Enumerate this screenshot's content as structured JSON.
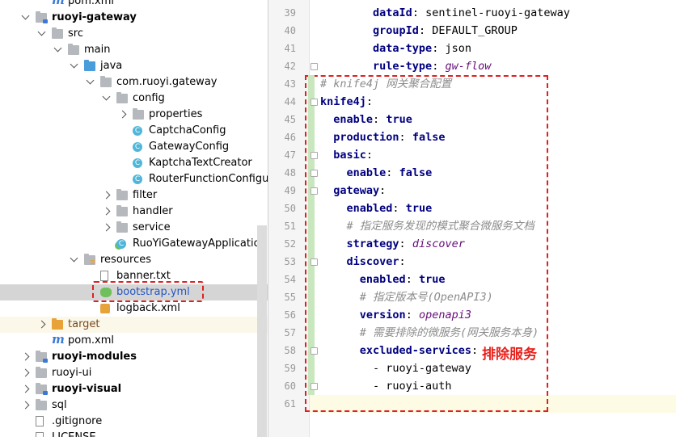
{
  "tree": {
    "rows": [
      {
        "label": "pom.xml",
        "icon": "maven-icon",
        "indent": 64,
        "arrow": "",
        "style": ""
      },
      {
        "label": "ruoyi-gateway",
        "icon": "module-folder-icon",
        "indent": 44,
        "arrow": "down",
        "style": "bold"
      },
      {
        "label": "src",
        "icon": "folder-icon",
        "indent": 64,
        "arrow": "down",
        "style": ""
      },
      {
        "label": "main",
        "icon": "folder-icon",
        "indent": 84,
        "arrow": "down",
        "style": ""
      },
      {
        "label": "java",
        "icon": "source-folder-icon",
        "indent": 104,
        "arrow": "down",
        "style": ""
      },
      {
        "label": "com.ruoyi.gateway",
        "icon": "package-icon",
        "indent": 124,
        "arrow": "down",
        "style": ""
      },
      {
        "label": "config",
        "icon": "package-icon",
        "indent": 144,
        "arrow": "down",
        "style": ""
      },
      {
        "label": "properties",
        "icon": "package-icon",
        "indent": 164,
        "arrow": "right",
        "style": ""
      },
      {
        "label": "CaptchaConfig",
        "icon": "class-icon",
        "indent": 164,
        "arrow": "",
        "style": ""
      },
      {
        "label": "GatewayConfig",
        "icon": "class-icon",
        "indent": 164,
        "arrow": "",
        "style": ""
      },
      {
        "label": "KaptchaTextCreator",
        "icon": "class-icon",
        "indent": 164,
        "arrow": "",
        "style": ""
      },
      {
        "label": "RouterFunctionConfigurat",
        "icon": "class-icon",
        "indent": 164,
        "arrow": "",
        "style": ""
      },
      {
        "label": "filter",
        "icon": "package-icon",
        "indent": 144,
        "arrow": "right",
        "style": ""
      },
      {
        "label": "handler",
        "icon": "package-icon",
        "indent": 144,
        "arrow": "right",
        "style": ""
      },
      {
        "label": "service",
        "icon": "package-icon",
        "indent": 144,
        "arrow": "right",
        "style": ""
      },
      {
        "label": "RuoYiGatewayApplication",
        "icon": "spring-class-icon",
        "indent": 144,
        "arrow": "",
        "style": ""
      },
      {
        "label": "resources",
        "icon": "resources-folder-icon",
        "indent": 104,
        "arrow": "down",
        "style": ""
      },
      {
        "label": "banner.txt",
        "icon": "text-file-icon",
        "indent": 124,
        "arrow": "",
        "style": ""
      },
      {
        "label": "bootstrap.yml",
        "icon": "yaml-file-icon",
        "indent": 124,
        "arrow": "",
        "style": "blue selected"
      },
      {
        "label": "logback.xml",
        "icon": "xml-file-icon",
        "indent": 124,
        "arrow": "",
        "style": ""
      },
      {
        "label": "target",
        "icon": "excluded-folder-icon",
        "indent": 64,
        "arrow": "right",
        "style": "brown highlighted"
      },
      {
        "label": "pom.xml",
        "icon": "maven-icon",
        "indent": 64,
        "arrow": "",
        "style": ""
      },
      {
        "label": "ruoyi-modules",
        "icon": "module-folder-icon",
        "indent": 44,
        "arrow": "right",
        "style": "bold"
      },
      {
        "label": "ruoyi-ui",
        "icon": "folder-icon",
        "indent": 44,
        "arrow": "right",
        "style": ""
      },
      {
        "label": "ruoyi-visual",
        "icon": "module-folder-icon",
        "indent": 44,
        "arrow": "right",
        "style": "bold"
      },
      {
        "label": "sql",
        "icon": "folder-icon",
        "indent": 44,
        "arrow": "right",
        "style": ""
      },
      {
        "label": ".gitignore",
        "icon": "gitignore-file-icon",
        "indent": 44,
        "arrow": "",
        "style": ""
      },
      {
        "label": "LICENSE",
        "icon": "text-file-icon",
        "indent": 44,
        "arrow": "",
        "style": ""
      }
    ]
  },
  "editor": {
    "lines": [
      {
        "num": "39",
        "tokens": [
          {
            "t": "        ",
            "c": "v"
          },
          {
            "t": "dataId",
            "c": "k"
          },
          {
            "t": ": sentinel-ruoyi-gateway",
            "c": "v"
          }
        ]
      },
      {
        "num": "40",
        "tokens": [
          {
            "t": "        ",
            "c": "v"
          },
          {
            "t": "groupId",
            "c": "k"
          },
          {
            "t": ": DEFAULT_GROUP",
            "c": "v"
          }
        ]
      },
      {
        "num": "41",
        "tokens": [
          {
            "t": "        ",
            "c": "v"
          },
          {
            "t": "data-type",
            "c": "k"
          },
          {
            "t": ": json",
            "c": "v"
          }
        ]
      },
      {
        "num": "42",
        "tokens": [
          {
            "t": "        ",
            "c": "v"
          },
          {
            "t": "rule-type",
            "c": "k"
          },
          {
            "t": ": ",
            "c": "v"
          },
          {
            "t": "gw-flow",
            "c": "vi"
          }
        ]
      },
      {
        "num": "43",
        "tokens": [
          {
            "t": "# knife4j 网关聚合配置",
            "c": "c"
          }
        ]
      },
      {
        "num": "44",
        "tokens": [
          {
            "t": "knife4j",
            "c": "k"
          },
          {
            "t": ":",
            "c": "v"
          }
        ]
      },
      {
        "num": "45",
        "tokens": [
          {
            "t": "  ",
            "c": "v"
          },
          {
            "t": "enable",
            "c": "k"
          },
          {
            "t": ": ",
            "c": "v"
          },
          {
            "t": "true",
            "c": "vb"
          }
        ]
      },
      {
        "num": "46",
        "tokens": [
          {
            "t": "  ",
            "c": "v"
          },
          {
            "t": "production",
            "c": "k"
          },
          {
            "t": ": ",
            "c": "v"
          },
          {
            "t": "false",
            "c": "vb"
          }
        ]
      },
      {
        "num": "47",
        "tokens": [
          {
            "t": "  ",
            "c": "v"
          },
          {
            "t": "basic",
            "c": "k"
          },
          {
            "t": ":",
            "c": "v"
          }
        ]
      },
      {
        "num": "48",
        "tokens": [
          {
            "t": "    ",
            "c": "v"
          },
          {
            "t": "enable",
            "c": "k"
          },
          {
            "t": ": ",
            "c": "v"
          },
          {
            "t": "false",
            "c": "vb"
          }
        ]
      },
      {
        "num": "49",
        "tokens": [
          {
            "t": "  ",
            "c": "v"
          },
          {
            "t": "gateway",
            "c": "k"
          },
          {
            "t": ":",
            "c": "v"
          }
        ]
      },
      {
        "num": "50",
        "tokens": [
          {
            "t": "    ",
            "c": "v"
          },
          {
            "t": "enabled",
            "c": "k"
          },
          {
            "t": ": ",
            "c": "v"
          },
          {
            "t": "true",
            "c": "vb"
          }
        ]
      },
      {
        "num": "51",
        "tokens": [
          {
            "t": "    ",
            "c": "v"
          },
          {
            "t": "# 指定服务发现的模式聚合微服务文档",
            "c": "c"
          }
        ]
      },
      {
        "num": "52",
        "tokens": [
          {
            "t": "    ",
            "c": "v"
          },
          {
            "t": "strategy",
            "c": "k"
          },
          {
            "t": ": ",
            "c": "v"
          },
          {
            "t": "discover",
            "c": "vi"
          }
        ]
      },
      {
        "num": "53",
        "tokens": [
          {
            "t": "    ",
            "c": "v"
          },
          {
            "t": "discover",
            "c": "k"
          },
          {
            "t": ":",
            "c": "v"
          }
        ]
      },
      {
        "num": "54",
        "tokens": [
          {
            "t": "      ",
            "c": "v"
          },
          {
            "t": "enabled",
            "c": "k"
          },
          {
            "t": ": ",
            "c": "v"
          },
          {
            "t": "true",
            "c": "vb"
          }
        ]
      },
      {
        "num": "55",
        "tokens": [
          {
            "t": "      ",
            "c": "v"
          },
          {
            "t": "# 指定版本号(OpenAPI3)",
            "c": "c"
          }
        ]
      },
      {
        "num": "56",
        "tokens": [
          {
            "t": "      ",
            "c": "v"
          },
          {
            "t": "version",
            "c": "k"
          },
          {
            "t": ": ",
            "c": "v"
          },
          {
            "t": "openapi3",
            "c": "vi"
          }
        ]
      },
      {
        "num": "57",
        "tokens": [
          {
            "t": "      ",
            "c": "v"
          },
          {
            "t": "# 需要排除的微服务(网关服务本身)",
            "c": "c"
          }
        ]
      },
      {
        "num": "58",
        "tokens": [
          {
            "t": "      ",
            "c": "v"
          },
          {
            "t": "excluded-services",
            "c": "k"
          },
          {
            "t": ":",
            "c": "v"
          }
        ]
      },
      {
        "num": "59",
        "tokens": [
          {
            "t": "        - ruoyi-gateway",
            "c": "v"
          }
        ]
      },
      {
        "num": "60",
        "tokens": [
          {
            "t": "        - ruoyi-auth",
            "c": "v"
          }
        ]
      },
      {
        "num": "61",
        "tokens": []
      }
    ],
    "annotation": "排除服务"
  },
  "colors": {
    "annotation": "#e8201b",
    "dashed_box": "#e02020",
    "key": "#000080",
    "comment": "#8c8c8c",
    "italic_value": "#660e7a"
  }
}
